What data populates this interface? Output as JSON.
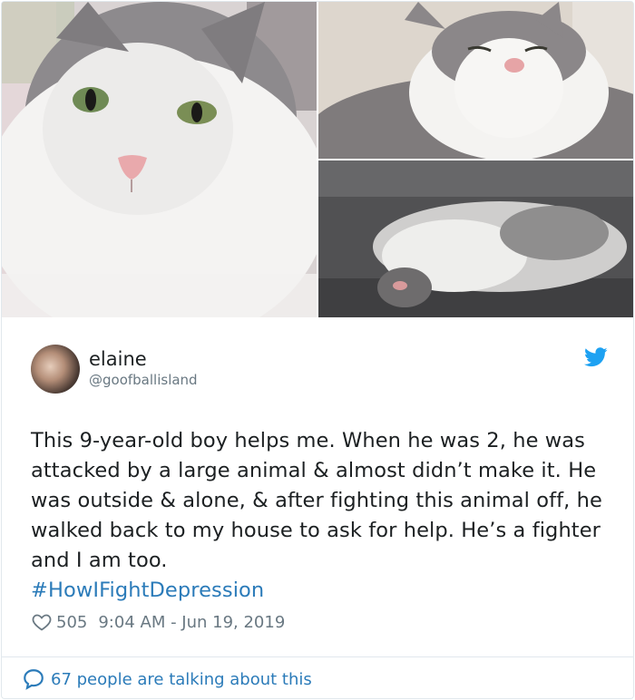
{
  "tweet": {
    "author": {
      "display_name": "elaine",
      "handle": "@goofballisland"
    },
    "text": "This 9-year-old boy helps me. When he was 2, he was attacked by a large animal & almost didn’t make it. He was outside & alone, & after fighting this animal off, he walked back to my house to ask for help. He’s a fighter and I am too.",
    "hashtag": "#HowIFightDepression",
    "likes": "505",
    "timestamp": "9:04 AM - Jun 19, 2019",
    "conversation": "67 people are talking about this"
  },
  "icons": {
    "brand": "twitter-bird-icon",
    "like": "heart-icon",
    "reply": "speech-bubble-icon"
  },
  "colors": {
    "link": "#2b7bb9",
    "text": "#1c2022",
    "muted": "#697882",
    "border": "#e1e8ed",
    "brand": "#1da1f2"
  }
}
